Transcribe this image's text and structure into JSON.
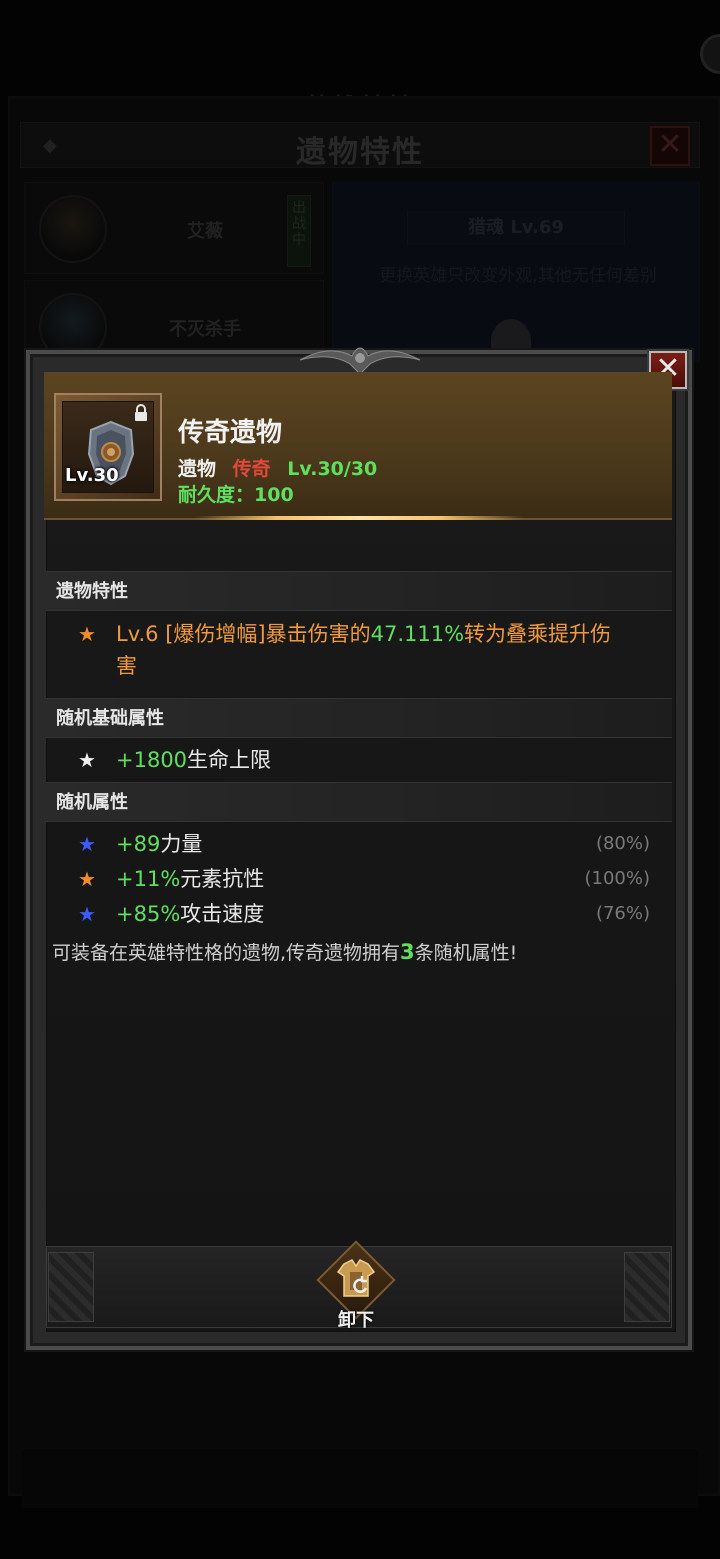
{
  "background": {
    "window_title": "遗物特性",
    "top_title": "英雄特性",
    "heroes": [
      {
        "name": "艾薇",
        "status": "出战中"
      },
      {
        "name": "不灭杀手"
      }
    ],
    "hero_level": "猎魂 Lv.69",
    "hint": "更换英雄只改变外观,其他无任何差别"
  },
  "item": {
    "name": "传奇遗物",
    "type": "遗物",
    "rarity": "传奇",
    "level": "Lv.30/30",
    "slot_level": "Lv.30",
    "durability": "耐久度：100"
  },
  "sections": {
    "trait_title": "遗物特性",
    "base_title": "随机基础属性",
    "random_title": "随机属性"
  },
  "trait": {
    "level": "Lv.6",
    "text_a": " [爆伤增幅]暴击伤害的",
    "value": "47.111%",
    "text_b": "转为叠乘提升伤",
    "text_c": "害"
  },
  "base_attr": {
    "value": "+1800",
    "label": "生命上限"
  },
  "random_attrs": [
    {
      "value": "+89",
      "label": "力量",
      "pct": "(80%)",
      "star": "blue"
    },
    {
      "value": "+11%",
      "label": "元素抗性",
      "pct": "(100%)",
      "star": "orange"
    },
    {
      "value": "+85%",
      "label": "攻击速度",
      "pct": "(76%)",
      "star": "blue"
    }
  ],
  "footer": {
    "text_a": "可装备在英雄特性格的遗物,传奇遗物拥有",
    "count": "3",
    "text_b": "条随机属性!"
  },
  "actions": {
    "unequip_label": "卸下"
  },
  "icons": {
    "close": "close-icon",
    "lock": "lock-icon",
    "star": "star-icon",
    "armor": "armor-icon",
    "relic": "relic-icon"
  },
  "colors": {
    "header_gold": "#5b4420",
    "green": "#5ee05e",
    "orange": "#f09a3c",
    "rarity_red": "#e2483a",
    "star_blue": "#3a5cff"
  }
}
